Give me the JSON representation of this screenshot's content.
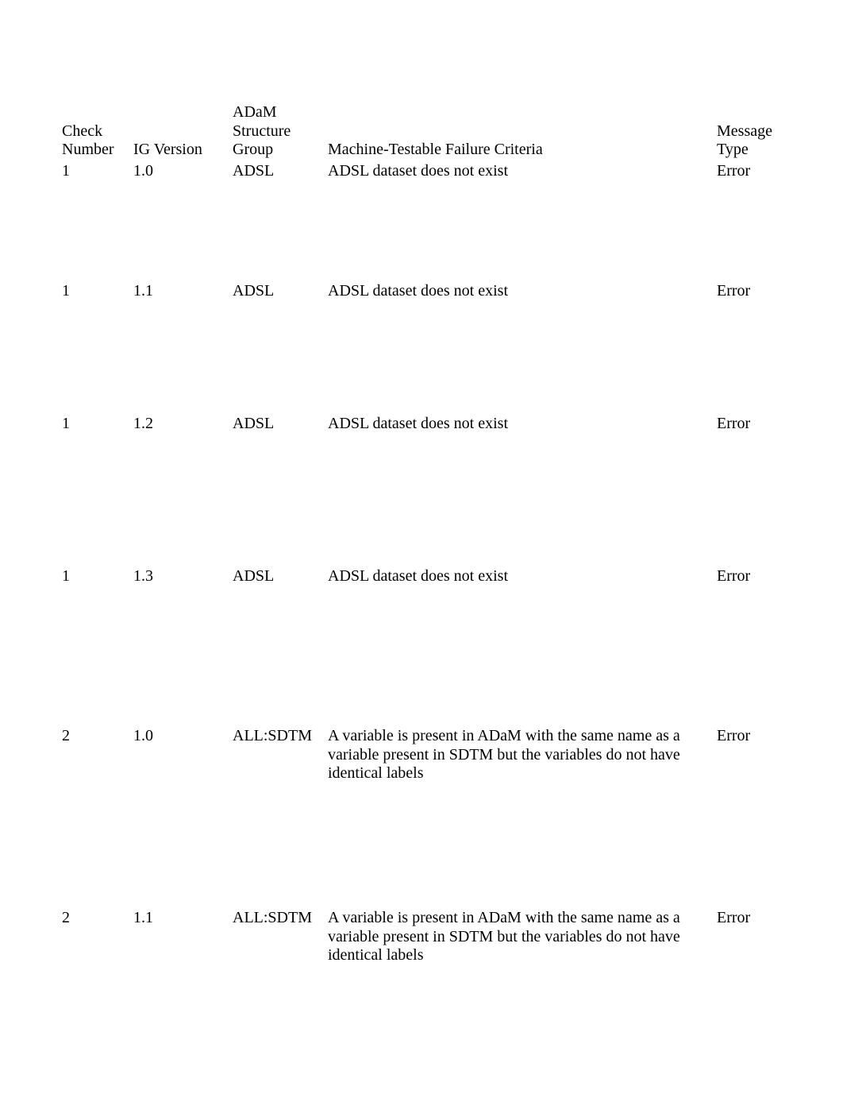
{
  "headers": {
    "check_number": "Check Number",
    "ig_version": "IG Version",
    "adam_structure_group": "ADaM Structure Group",
    "criteria": "Machine-Testable Failure Criteria",
    "message_type": "Message Type"
  },
  "rows": [
    {
      "check_number": "1",
      "ig_version": "1.0",
      "adam_structure_group": "ADSL",
      "criteria": "ADSL dataset does not exist",
      "message_type": "Error"
    },
    {
      "check_number": "1",
      "ig_version": "1.1",
      "adam_structure_group": "ADSL",
      "criteria": "ADSL dataset does not exist",
      "message_type": "Error"
    },
    {
      "check_number": "1",
      "ig_version": "1.2",
      "adam_structure_group": "ADSL",
      "criteria": "ADSL dataset does not exist",
      "message_type": "Error"
    },
    {
      "check_number": "1",
      "ig_version": "1.3",
      "adam_structure_group": "ADSL",
      "criteria": "ADSL dataset does not exist",
      "message_type": "Error"
    },
    {
      "check_number": "2",
      "ig_version": "1.0",
      "adam_structure_group": "ALL:SDTM",
      "criteria": "A variable is present in ADaM with the same name as a variable present in SDTM but the variables do not have identical labels",
      "message_type": "Error"
    },
    {
      "check_number": "2",
      "ig_version": "1.1",
      "adam_structure_group": "ALL:SDTM",
      "criteria": "A variable is present in ADaM with the same name as a variable present in SDTM but the variables do not have identical labels",
      "message_type": "Error"
    }
  ]
}
